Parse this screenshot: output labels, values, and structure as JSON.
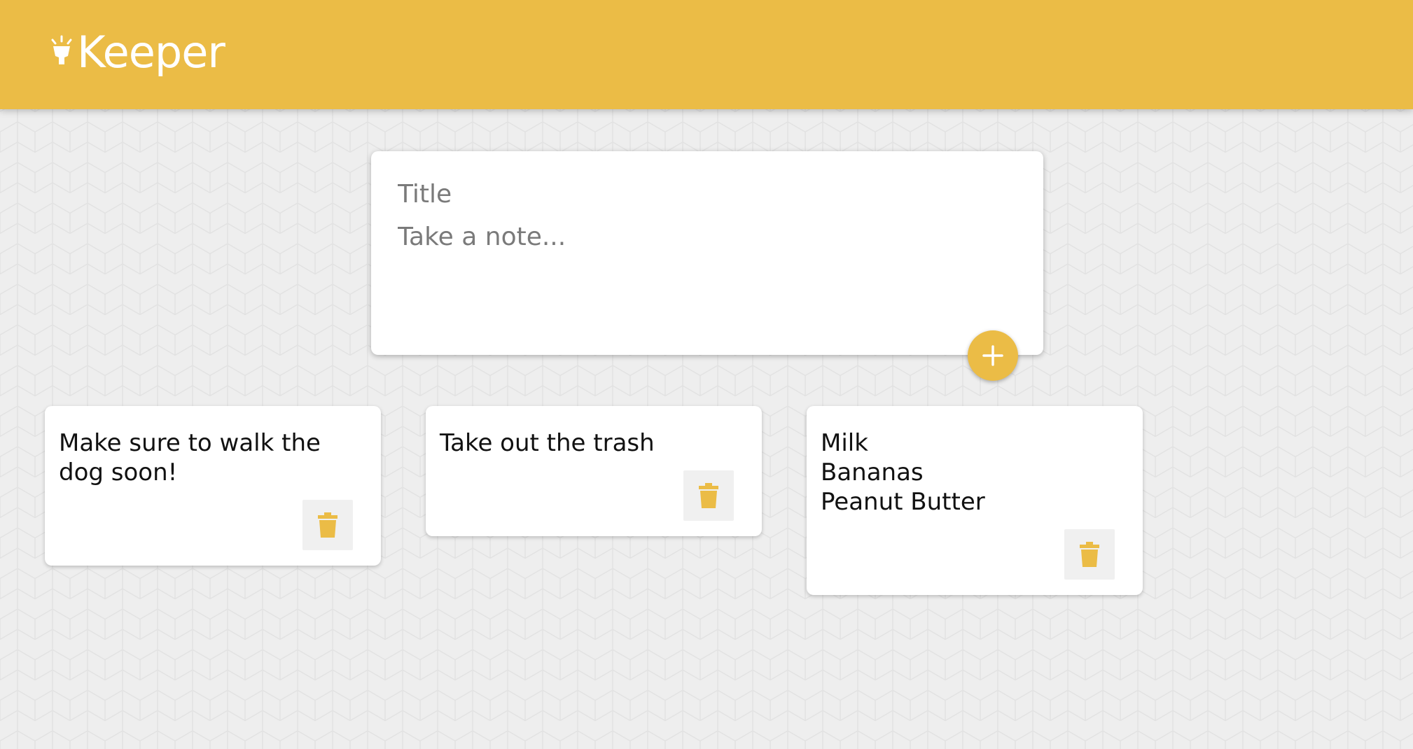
{
  "colors": {
    "accent": "#ebbc46",
    "background": "#eeeeee",
    "card": "#ffffff"
  },
  "header": {
    "app_name": "Keeper",
    "logo_icon": "lightbulb-icon"
  },
  "create_area": {
    "title_placeholder": "Title",
    "content_placeholder": "Take a note...",
    "add_icon": "plus-icon"
  },
  "notes": [
    {
      "content": "Make sure to walk the dog soon!",
      "delete_icon": "trash-icon"
    },
    {
      "content": "Take out the trash",
      "delete_icon": "trash-icon"
    },
    {
      "content": "Milk\nBananas\nPeanut Butter",
      "delete_icon": "trash-icon"
    }
  ]
}
